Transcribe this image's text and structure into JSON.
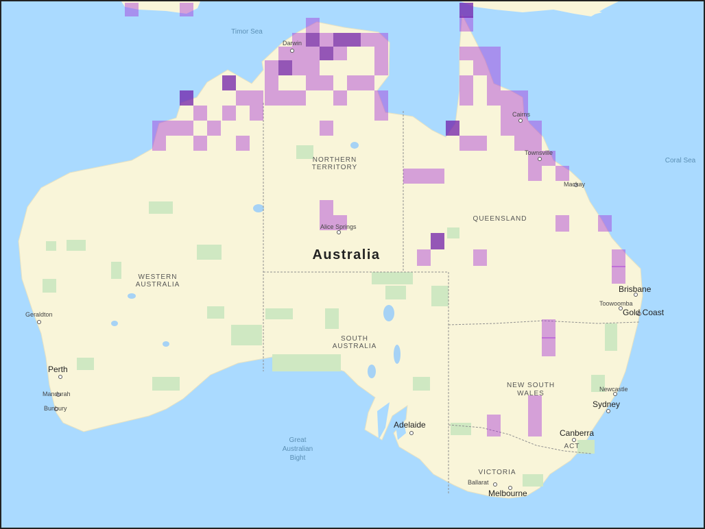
{
  "map": {
    "title": "Australia",
    "colors": {
      "ocean": "#aadaff",
      "land": "#f9f5d9",
      "park": "#cfe8c2",
      "lake": "#a6d2f5",
      "border": "#8f8f8f",
      "overlay": "#a52ad6",
      "overlay_dark": "#5e1a9a",
      "road": "#ffffff"
    },
    "labels": {
      "australia": "Australia",
      "timor_sea": "Timor Sea",
      "coral_sea": "Coral Sea",
      "gab_1": "Great",
      "gab_2": "Australian",
      "gab_3": "Bight",
      "nt_1": "NORTHERN",
      "nt_2": "TERRITORY",
      "wa_1": "WESTERN",
      "wa_2": "AUSTRALIA",
      "sa_1": "SOUTH",
      "sa_2": "AUSTRALIA",
      "qld": "QUEENSLAND",
      "nsw_1": "NEW SOUTH",
      "nsw_2": "WALES",
      "vic": "VICTORIA",
      "act": "ACT"
    },
    "cities": [
      {
        "name": "Darwin"
      },
      {
        "name": "Cairns"
      },
      {
        "name": "Townsville"
      },
      {
        "name": "Mackay"
      },
      {
        "name": "Alice Springs"
      },
      {
        "name": "Brisbane"
      },
      {
        "name": "Toowoomba"
      },
      {
        "name": "Gold Coast"
      },
      {
        "name": "Geraldton"
      },
      {
        "name": "Perth"
      },
      {
        "name": "Mandurah"
      },
      {
        "name": "Bunbury"
      },
      {
        "name": "Adelaide"
      },
      {
        "name": "Newcastle"
      },
      {
        "name": "Sydney"
      },
      {
        "name": "Canberra"
      },
      {
        "name": "Ballarat"
      },
      {
        "name": "Melbourne"
      }
    ]
  }
}
